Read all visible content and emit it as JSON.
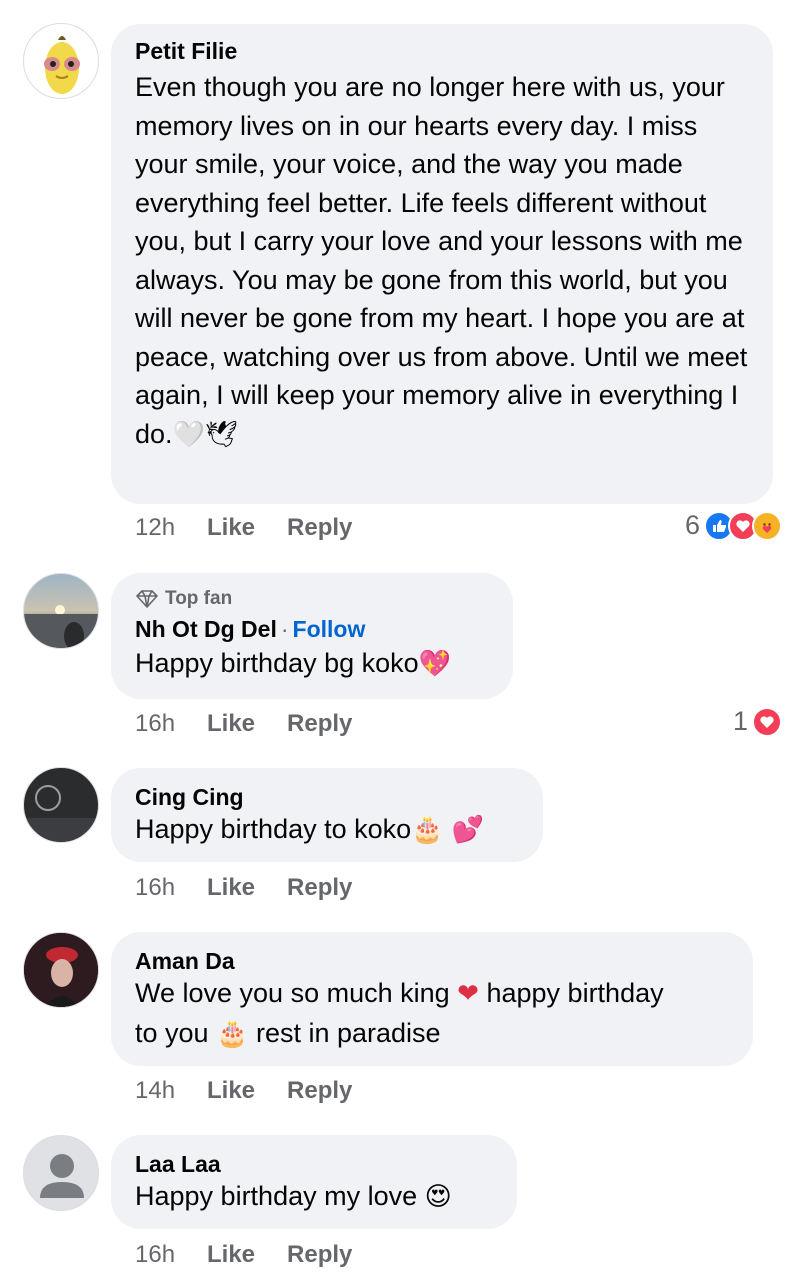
{
  "comments": [
    {
      "name": "Petit Filie",
      "text": "Even though you are no longer here with us, your memory lives on in our hearts every day. I miss your smile, your voice, and the way you made everything feel better. Life feels different without you, but I carry your love and your lessons with me always. You may be gone from this world, but you will never be gone from my heart. I hope you are at peace, watching over us from above. Until we meet again, I will keep your memory alive in everything I do.",
      "emoji": "🤍🕊",
      "time": "12h",
      "like": "Like",
      "reply": "Reply",
      "reaction_count": "6"
    },
    {
      "badge": "Top fan",
      "name": "Nh Ot Dg Del",
      "follow": "Follow",
      "text": "Happy birthday bg koko",
      "emoji": "💖",
      "time": "16h",
      "like": "Like",
      "reply": "Reply",
      "reaction_count": "1"
    },
    {
      "name": "Cing Cing",
      "text": "Happy birthday to koko",
      "emoji": "🎂 💕",
      "time": "16h",
      "like": "Like",
      "reply": "Reply"
    },
    {
      "name": "Aman Da",
      "text_line1": "We love you so much king",
      "emoji1": "❤",
      "text_line1b": "happy birthday",
      "text_line2": "to you",
      "emoji2": "🎂",
      "text_line2b": "rest in paradise",
      "time": "14h",
      "like": "Like",
      "reply": "Reply"
    },
    {
      "name": "Laa Laa",
      "text": "Happy birthday my love",
      "emoji": "😍",
      "time": "16h",
      "like": "Like",
      "reply": "Reply"
    }
  ],
  "colors": {
    "bubble": "#f0f2f5",
    "meta_text": "#65676b",
    "follow": "#0064d1",
    "like_reaction": "#1877f2",
    "love_reaction": "#f33e58",
    "care_reaction": "#f7b125"
  }
}
